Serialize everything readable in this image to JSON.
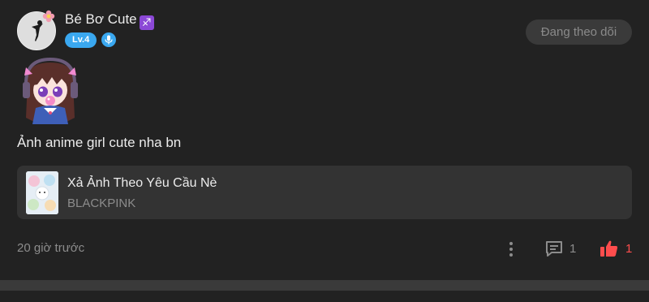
{
  "post": {
    "username": "Bé Bơ Cute",
    "zodiac_symbol": "♐",
    "level": "Lv.4",
    "follow_label": "Đang theo dõi",
    "caption": "Ảnh anime girl cute nha bn",
    "time": "20 giờ trước",
    "comment_count": "1",
    "like_count": "1"
  },
  "music": {
    "title": "Xả Ảnh Theo Yêu Cầu Nè",
    "artist": "BLACKPINK"
  },
  "colors": {
    "background": "#222222",
    "card": "#333333",
    "level_badge": "#3aa8f0",
    "like": "#ff4d4d",
    "muted_text": "#8c8c8c"
  },
  "icons": {
    "zodiac": "sagittarius-icon",
    "mic": "microphone-icon",
    "more": "more-vertical-icon",
    "comment": "comment-icon",
    "like": "thumbs-up-icon"
  }
}
